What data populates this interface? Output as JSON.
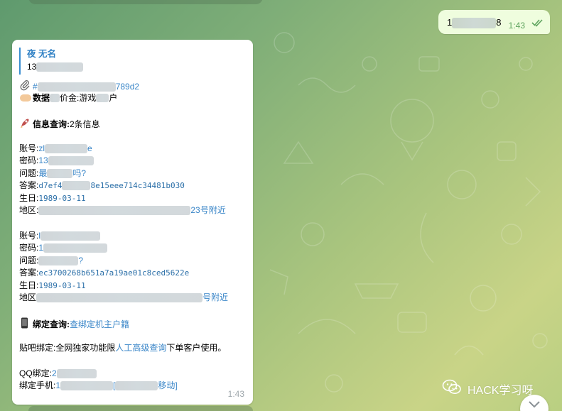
{
  "outgoing": {
    "text_visible": "1",
    "text_suffix": "8",
    "time": "1:43",
    "status_icon": "double-check-icon"
  },
  "incoming": {
    "reply": {
      "name": "夜 无名",
      "text": "13"
    },
    "file_link": "#",
    "file_link_tail": "789d2",
    "lines": {
      "data_line_label": "数据",
      "data_line_partial": "价金:游戏",
      "data_line_end": "户",
      "info_label": "信息查询:",
      "info_value": "2条信息",
      "r1_account_label": "账号:",
      "r1_account_start": "zl",
      "r1_account_end": "e",
      "r1_pwd_label": "密码:",
      "r1_pwd_start": "13",
      "r1_q_label": "问题:",
      "r1_q_start": "最",
      "r1_q_end": "吗?",
      "r1_ans_label": "答案:",
      "r1_ans_start": "d7ef4",
      "r1_ans_end": "8e15eee714c34481b030",
      "r1_bday_label": "生日:",
      "r1_bday": "1989-03-11",
      "r1_addr_label": "地区:",
      "r1_addr_end": "23号附近",
      "r2_account_label": "账号:",
      "r2_account_start": "l",
      "r2_pwd_label": "密码:",
      "r2_pwd_start": "1",
      "r2_q_label": "问题:",
      "r2_q_end": "?",
      "r2_ans_label": "答案:",
      "r2_ans": "ec3700268b651a7a19ae01c8ced5622e",
      "r2_bday_label": "生日:",
      "r2_bday": "1989-03-11",
      "r2_addr_label": "地区",
      "r2_addr_end": "号附近",
      "bind_label": "绑定查询:",
      "bind_link": "查绑定机主户籍",
      "tieba_prefix": "贴吧绑定:全网独家功能限",
      "tieba_link": "人工高级查询",
      "tieba_suffix": "下单客户使用。",
      "qq_label": "QQ绑定:",
      "qq_start": "2",
      "phone_label": "绑定手机:",
      "phone_start": "1",
      "phone_mid": "[",
      "phone_end": "移动]"
    },
    "time": "1:43"
  },
  "watermark": {
    "text": "HACK学习呀",
    "icon": "wechat-icon"
  },
  "scroll_button": {
    "icon": "chevron-down-icon"
  },
  "colors": {
    "link": "#3a86c8",
    "reply_bar": "#2f80c4",
    "out_bubble": "#effdde",
    "tick": "#5fa45f"
  }
}
